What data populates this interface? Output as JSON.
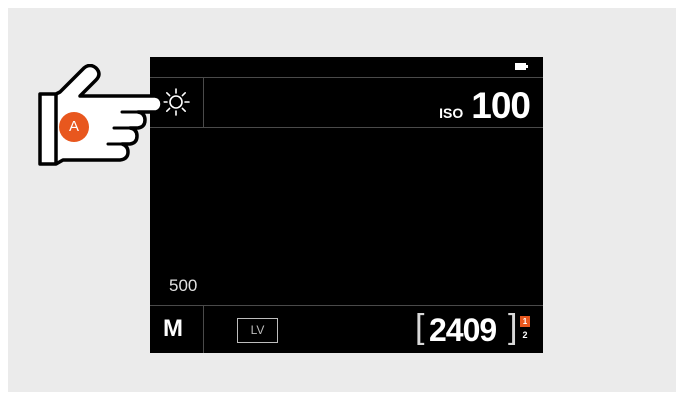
{
  "screen": {
    "iso_label": "ISO",
    "iso_value": "100",
    "shutter_speed": "500",
    "exposure_mode": "M",
    "live_view_label": "LV",
    "shot_count": "2409",
    "card_slot_active": "1",
    "card_slot_inactive": "2",
    "white_balance_icon": "sun-icon",
    "battery_icon": "battery-icon"
  },
  "callout": {
    "badge_label": "A",
    "pointer_icon": "pointing-hand-icon"
  },
  "colors": {
    "accent": "#e8571e",
    "screen_bg": "#000000",
    "panel_bg": "#ebebeb"
  }
}
